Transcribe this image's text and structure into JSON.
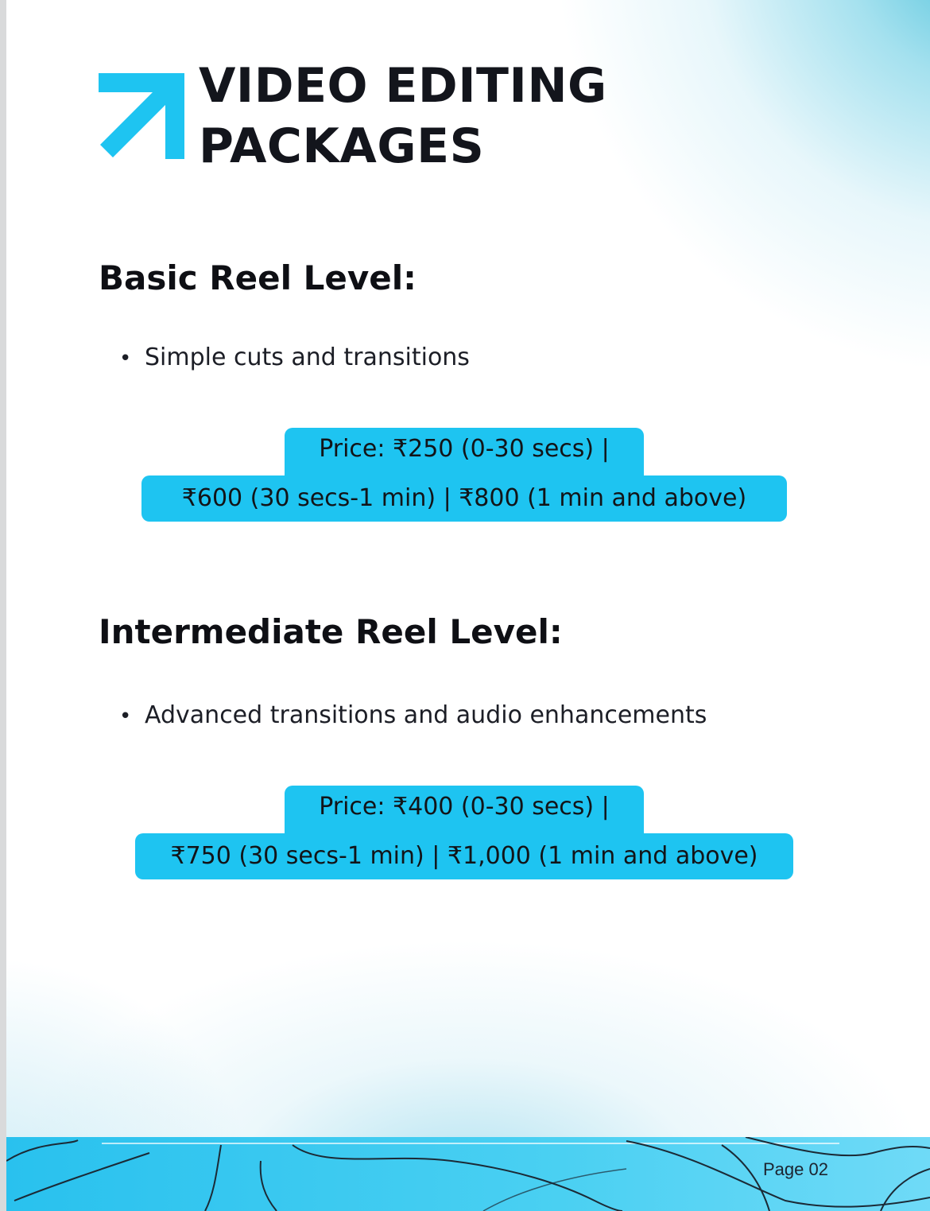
{
  "header": {
    "title_line1": "VIDEO EDITING",
    "title_line2": "PACKAGES",
    "accent_color": "#1EC4F1",
    "icon": "arrow-up-right-icon"
  },
  "sections": [
    {
      "heading": "Basic Reel Level:",
      "bullet": "Simple cuts and transitions",
      "price_line1": "Price: ₹250 (0-30 secs) |",
      "price_line2": "₹600 (30 secs-1 min) | ₹800 (1 min and above)"
    },
    {
      "heading": "Intermediate Reel Level:",
      "bullet": "Advanced transitions and audio enhancements",
      "price_line1": "Price: ₹400 (0-30 secs) |",
      "price_line2": "₹750 (30 secs-1 min) | ₹1,000 (1 min and above)"
    }
  ],
  "footer": {
    "page_label": "Page 02",
    "background_color": "#29C1EE"
  }
}
